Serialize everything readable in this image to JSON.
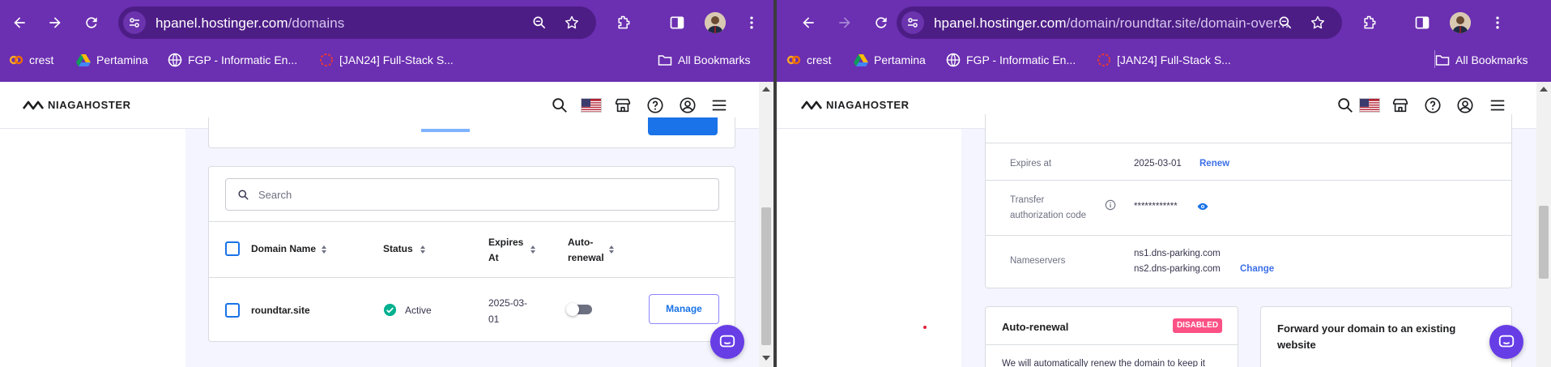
{
  "left": {
    "url_main": "hpanel.hostinger.com",
    "url_path": "/domains",
    "bookmarks": [
      "crest",
      "Pertamina",
      "FGP - Informatic En...",
      "[JAN24] Full-Stack S..."
    ],
    "all_bookmarks": "All Bookmarks",
    "logo": "NIAGAHOSTER",
    "search_placeholder": "Search",
    "columns": {
      "domain_name": "Domain Name",
      "status": "Status",
      "expires_1": "Expires",
      "expires_2": "At",
      "auto_1": "Auto-",
      "auto_2": "renewal"
    },
    "row": {
      "domain": "roundtar.site",
      "status": "Active",
      "expires_1": "2025-03-",
      "expires_2": "01",
      "manage": "Manage"
    }
  },
  "right": {
    "url_main": "hpanel.hostinger.com",
    "url_path": "/domain/roundtar.site/domain-over...",
    "bookmarks": [
      "crest",
      "Pertamina",
      "FGP - Informatic En...",
      "[JAN24] Full-Stack S..."
    ],
    "all_bookmarks": "All Bookmarks",
    "logo": "NIAGAHOSTER",
    "expires_label": "Expires at",
    "expires_value": "2025-03-01",
    "renew": "Renew",
    "transfer_label_1": "Transfer",
    "transfer_label_2": "authorization code",
    "transfer_value": "************",
    "nameservers_label": "Nameservers",
    "ns1": "ns1.dns-parking.com",
    "ns2": "ns2.dns-parking.com",
    "change": "Change",
    "auto_renewal_title": "Auto-renewal",
    "disabled_badge": "DISABLED",
    "auto_renewal_desc": "We will automatically renew the domain to keep it",
    "forward_title_1": "Forward your domain to an existing",
    "forward_title_2": "website"
  },
  "colors": {
    "chrome": "#6b2fb1",
    "omnibox": "#4d1d86",
    "brand": "#673de6",
    "active_green": "#00b090",
    "disabled_pink": "#fc5185",
    "link": "#3c6fe8"
  }
}
